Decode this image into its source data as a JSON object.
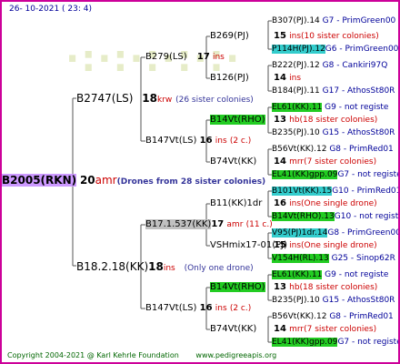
{
  "date": "26- 10-2021 ( 23: 4)",
  "root": {
    "id": "B2005(RKN)",
    "num": "20",
    "info": "amr",
    "note": "(Drones from 28 sister colonies)"
  },
  "g1": [
    {
      "id": "B2747(LS)",
      "num": "18",
      "info": "krw",
      "note": "(26 sister colonies)"
    },
    {
      "id": "B18.2.18(KK)",
      "num": "18",
      "info": "ins",
      "note": "(Only one drone)"
    }
  ],
  "g2": [
    {
      "id": "B279(LS)",
      "num": "17",
      "info": "ins"
    },
    {
      "id": "B147Vt(LS)",
      "num": "16",
      "info": "ins",
      "note": "(2 c.)"
    },
    {
      "id": "B17.1.537(KK)",
      "num": "17",
      "info": "amr",
      "note": "(11 c.)"
    },
    {
      "id": "B147Vt(LS)",
      "num": "16",
      "info": "ins",
      "note": "(2 c.)"
    }
  ],
  "g3": [
    {
      "id": "B269(PJ)",
      "num": "15",
      "info": "ins",
      "note": "(10 sister colonies)"
    },
    {
      "id": "B126(PJ)",
      "num": "14",
      "info": "ins"
    },
    {
      "id": "B14Vt(RHO)",
      "num": "13",
      "info": "hb",
      "note": "(18 sister colonies)"
    },
    {
      "id": "B74Vt(KK)",
      "num": "14",
      "info": "mrr",
      "note": "(7 sister colonies)"
    },
    {
      "id": "B11(KK)1dr",
      "num": "16",
      "info": "ins",
      "note": "(One single drone)"
    },
    {
      "id": "VSHmix17-01(PJ)",
      "num": "15",
      "info": "ins",
      "note": "(One single drone)"
    },
    {
      "id": "B14Vt(RHO)",
      "num": "13",
      "info": "hb",
      "note": "(18 sister colonies)"
    },
    {
      "id": "B74Vt(KK)",
      "num": "14",
      "info": "mrr",
      "note": "(7 sister colonies)"
    }
  ],
  "g4": [
    {
      "id": "B307(PJ).14",
      "info": "G7 - PrimGreen00"
    },
    {
      "id": "P114H(PJ).12",
      "info": "G6 - PrimGreen00"
    },
    {
      "id": "B222(PJ).12",
      "info": "G8 - Cankiri97Q"
    },
    {
      "id": "B184(PJ).11",
      "info": "G17 - AthosSt80R"
    },
    {
      "id": "EL61(KK).11",
      "info": "G9 - not registe"
    },
    {
      "id": "B235(PJ).10",
      "info": "G15 - AthosSt80R"
    },
    {
      "id": "B56Vt(KK).12",
      "info": "G8 - PrimRed01"
    },
    {
      "id": "EL41(KK)gpp.09",
      "info": "G7 - not registe"
    },
    {
      "id": "B101Vt(KK).15",
      "info": "G10 - PrimRed01"
    },
    {
      "id": "B14Vt(RHO).13",
      "info": "G10 - not registe"
    },
    {
      "id": "V95(PJ)1dr.14",
      "info": "G8 - PrimGreen00"
    },
    {
      "id": "V154H(RL).13",
      "info": "G25 - Sinop62R"
    },
    {
      "id": "EL61(KK).11",
      "info": "G9 - not registe"
    },
    {
      "id": "B235(PJ).10",
      "info": "G15 - AthosSt80R"
    },
    {
      "id": "B56Vt(KK).12",
      "info": "G8 - PrimRed01"
    },
    {
      "id": "EL41(KK)gpp.09",
      "info": "G7 - not registe"
    }
  ],
  "footer": {
    "copyright": "Copyright 2004-2021 @ Karl Kehrle Foundation",
    "url": "www.pedigreeapis.org"
  }
}
